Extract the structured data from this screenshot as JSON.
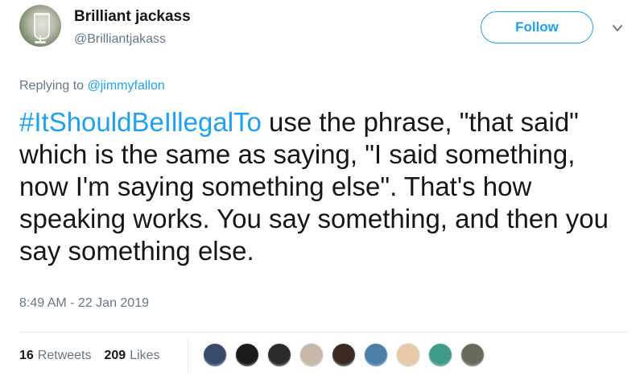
{
  "author": {
    "display_name": "Brilliant jackass",
    "handle": "@Brilliantjakass"
  },
  "follow_button": {
    "label": "Follow"
  },
  "reply": {
    "prefix": "Replying to ",
    "mention": "@jimmyfallon"
  },
  "tweet": {
    "hashtag": "#ItShouldBeIllegalTo",
    "body": " use the phrase, \"that said\" which is the same as saying, \"I said something, now I'm saying something else\". That's how speaking works. You say something, and then you say something else."
  },
  "timestamp": "8:49 AM - 22 Jan 2019",
  "stats": {
    "retweets_count": "16",
    "retweets_label": "Retweets",
    "likes_count": "209",
    "likes_label": "Likes"
  },
  "likers": [
    {
      "color": "#3a4a6a"
    },
    {
      "color": "#1a1a1a"
    },
    {
      "color": "#2b2b2b"
    },
    {
      "color": "#c9b8a8"
    },
    {
      "color": "#3b2a22"
    },
    {
      "color": "#4a7fa8"
    },
    {
      "color": "#e8c9a8"
    },
    {
      "color": "#3f9a8a"
    },
    {
      "color": "#6a6a5a"
    }
  ],
  "colors": {
    "accent": "#1da1f2",
    "text": "#14171a",
    "muted": "#657786"
  }
}
